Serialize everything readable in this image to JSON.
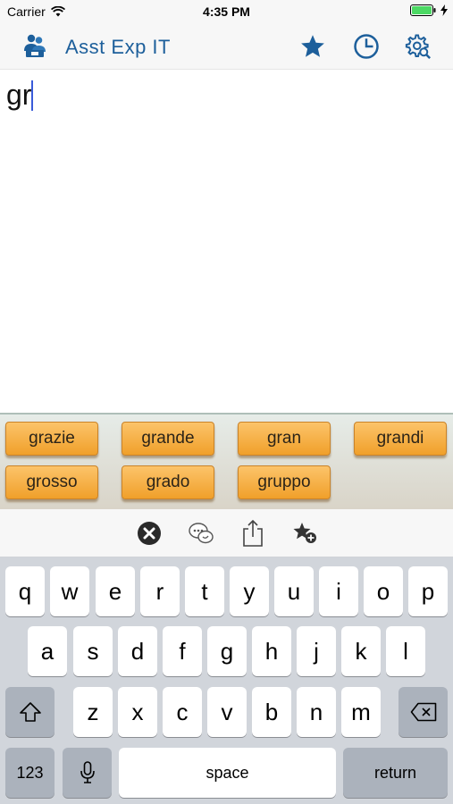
{
  "status_bar": {
    "carrier": "Carrier",
    "time": "4:35 PM"
  },
  "nav": {
    "title": "Asst Exp IT",
    "accent_color": "#1d5f9b"
  },
  "editor": {
    "typed_text": "gr"
  },
  "suggestions": [
    "grazie",
    "grande",
    "gran",
    "grandi",
    "grosso",
    "grado",
    "gruppo"
  ],
  "toolbar": {
    "icons": [
      "clear-icon",
      "chat-bubbles-icon",
      "share-icon",
      "favorite-add-icon"
    ]
  },
  "keyboard": {
    "row1": [
      "q",
      "w",
      "e",
      "r",
      "t",
      "y",
      "u",
      "i",
      "o",
      "p"
    ],
    "row2": [
      "a",
      "s",
      "d",
      "f",
      "g",
      "h",
      "j",
      "k",
      "l"
    ],
    "row3": [
      "z",
      "x",
      "c",
      "v",
      "b",
      "n",
      "m"
    ],
    "numbers_label": "123",
    "space_label": "space",
    "return_label": "return"
  }
}
